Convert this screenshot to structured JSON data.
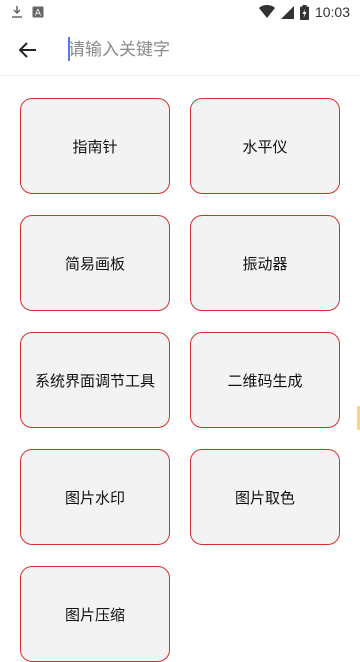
{
  "status": {
    "time": "10:03",
    "icons": [
      "download-icon",
      "a-notification-icon",
      "wifi-icon",
      "signal-icon",
      "battery-icon"
    ]
  },
  "search": {
    "placeholder": "请输入关键字",
    "value": ""
  },
  "tools": [
    {
      "label": "指南针"
    },
    {
      "label": "水平仪"
    },
    {
      "label": "简易画板"
    },
    {
      "label": "振动器"
    },
    {
      "label": "系统界面调节工具"
    },
    {
      "label": "二维码生成"
    },
    {
      "label": "图片水印"
    },
    {
      "label": "图片取色"
    },
    {
      "label": "图片压缩"
    }
  ],
  "colors": {
    "tile_border": "#d32f2f",
    "tile_bg": "#f3f3f3",
    "caret": "#5b7be0"
  }
}
